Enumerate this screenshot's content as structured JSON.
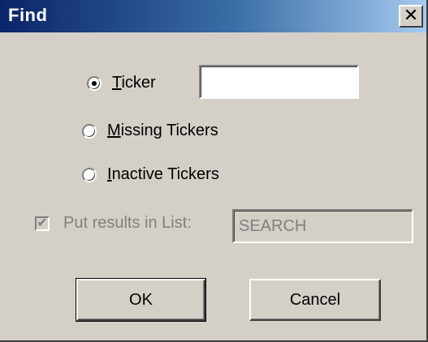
{
  "window": {
    "title": "Find",
    "close_label": "✕"
  },
  "search": {
    "options": [
      {
        "prefix": "",
        "mnemonic": "T",
        "suffix": "icker",
        "checked": true
      },
      {
        "prefix": "",
        "mnemonic": "M",
        "suffix": "issing Tickers",
        "checked": false
      },
      {
        "prefix": "",
        "mnemonic": "I",
        "suffix": "nactive Tickers",
        "checked": false
      }
    ],
    "ticker_value": ""
  },
  "results": {
    "label": "Put results in List:",
    "checked": true,
    "enabled": false,
    "list_name": "SEARCH"
  },
  "buttons": {
    "ok": "OK",
    "cancel": "Cancel"
  }
}
